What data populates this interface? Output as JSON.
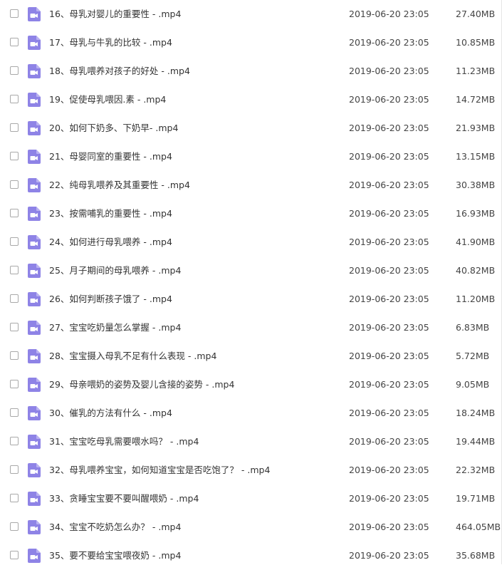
{
  "colors": {
    "icon_color": "#8e83e6",
    "checkbox_border": "#a9a9a9",
    "text": "#333333"
  },
  "icon_name": "video-file-icon",
  "files": [
    {
      "name": "16、母乳对婴儿的重要性 - .mp4",
      "date": "2019-06-20 23:05",
      "size": "27.40MB"
    },
    {
      "name": "17、母乳与牛乳的比较 - .mp4",
      "date": "2019-06-20 23:05",
      "size": "10.85MB"
    },
    {
      "name": "18、母乳喂养对孩子的好处 - .mp4",
      "date": "2019-06-20 23:05",
      "size": "11.23MB"
    },
    {
      "name": "19、促使母乳喂因.素 - .mp4",
      "date": "2019-06-20 23:05",
      "size": "14.72MB"
    },
    {
      "name": "20、如何下奶多、下奶早- .mp4",
      "date": "2019-06-20 23:05",
      "size": "21.93MB"
    },
    {
      "name": "21、母婴同室的重要性 - .mp4",
      "date": "2019-06-20 23:05",
      "size": "13.15MB"
    },
    {
      "name": "22、纯母乳喂养及其重要性 - .mp4",
      "date": "2019-06-20 23:05",
      "size": "30.38MB"
    },
    {
      "name": "23、按需哺乳的重要性 - .mp4",
      "date": "2019-06-20 23:05",
      "size": "16.93MB"
    },
    {
      "name": "24、如何进行母乳喂养 - .mp4",
      "date": "2019-06-20 23:05",
      "size": "41.90MB"
    },
    {
      "name": "25、月子期间的母乳喂养 - .mp4",
      "date": "2019-06-20 23:05",
      "size": "40.82MB"
    },
    {
      "name": "26、如何判断孩子饿了 - .mp4",
      "date": "2019-06-20 23:05",
      "size": "11.20MB"
    },
    {
      "name": "27、宝宝吃奶量怎么掌握 - .mp4",
      "date": "2019-06-20 23:05",
      "size": "6.83MB"
    },
    {
      "name": "28、宝宝摄入母乳不足有什么表现 - .mp4",
      "date": "2019-06-20 23:05",
      "size": "5.72MB"
    },
    {
      "name": "29、母亲喂奶的姿势及婴儿含接的姿势 - .mp4",
      "date": "2019-06-20 23:05",
      "size": "9.05MB"
    },
    {
      "name": "30、催乳的方法有什么 - .mp4",
      "date": "2019-06-20 23:05",
      "size": "18.24MB"
    },
    {
      "name": "31、宝宝吃母乳需要喂水吗？ - .mp4",
      "date": "2019-06-20 23:05",
      "size": "19.44MB"
    },
    {
      "name": "32、母乳喂养宝宝，如何知道宝宝是否吃饱了？ - .mp4",
      "date": "2019-06-20 23:05",
      "size": "22.32MB"
    },
    {
      "name": "33、贪睡宝宝要不要叫醒喂奶 - .mp4",
      "date": "2019-06-20 23:05",
      "size": "19.71MB"
    },
    {
      "name": "34、宝宝不吃奶怎么办？ - .mp4",
      "date": "2019-06-20 23:05",
      "size": "464.05MB"
    },
    {
      "name": "35、要不要给宝宝喂夜奶 - .mp4",
      "date": "2019-06-20 23:05",
      "size": "35.68MB"
    }
  ]
}
